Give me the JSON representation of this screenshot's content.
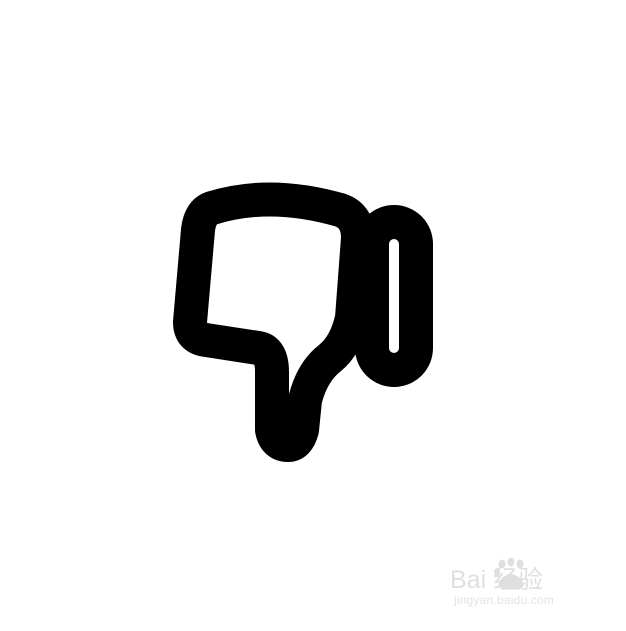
{
  "image": {
    "background": "#ffffff",
    "icon": {
      "name": "thumbs-down-icon",
      "stroke": "#000000",
      "fill": "#ffffff"
    },
    "watermark": {
      "brand_text": "Bai 经验",
      "url": "jingyan.baidu.com",
      "color": "#8f8f8f"
    }
  }
}
